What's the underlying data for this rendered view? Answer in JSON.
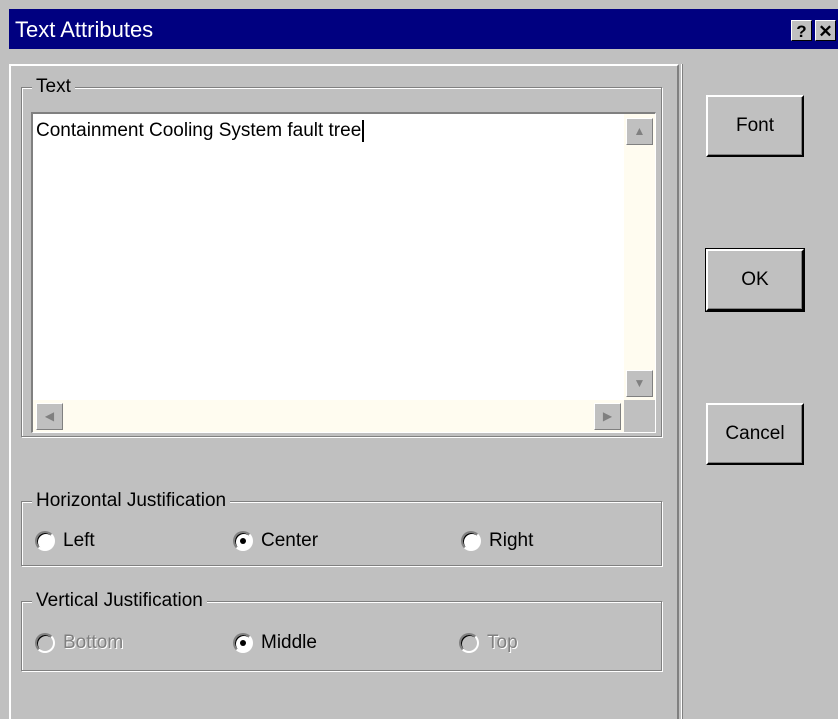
{
  "window": {
    "title": "Text Attributes",
    "help_label": "?",
    "close_label": "✕"
  },
  "text_group": {
    "legend": "Text",
    "value": "Containment Cooling System fault tree"
  },
  "horizontal_group": {
    "legend": "Horizontal Justification",
    "options": [
      {
        "label": "Left",
        "checked": false,
        "enabled": true
      },
      {
        "label": "Center",
        "checked": true,
        "enabled": true
      },
      {
        "label": "Right",
        "checked": false,
        "enabled": true
      }
    ]
  },
  "vertical_group": {
    "legend": "Vertical Justification",
    "options": [
      {
        "label": "Bottom",
        "checked": false,
        "enabled": false
      },
      {
        "label": "Middle",
        "checked": true,
        "enabled": true
      },
      {
        "label": "Top",
        "checked": false,
        "enabled": false
      }
    ]
  },
  "buttons": {
    "font": "Font",
    "ok": "OK",
    "cancel": "Cancel"
  },
  "colors": {
    "titlebar": "#000080",
    "face": "#c0c0c0",
    "scrollbar_track": "#fffcf0"
  },
  "icons": {
    "scroll_up": "triangle-up",
    "scroll_down": "triangle-down",
    "scroll_left": "triangle-left",
    "scroll_right": "triangle-right"
  }
}
